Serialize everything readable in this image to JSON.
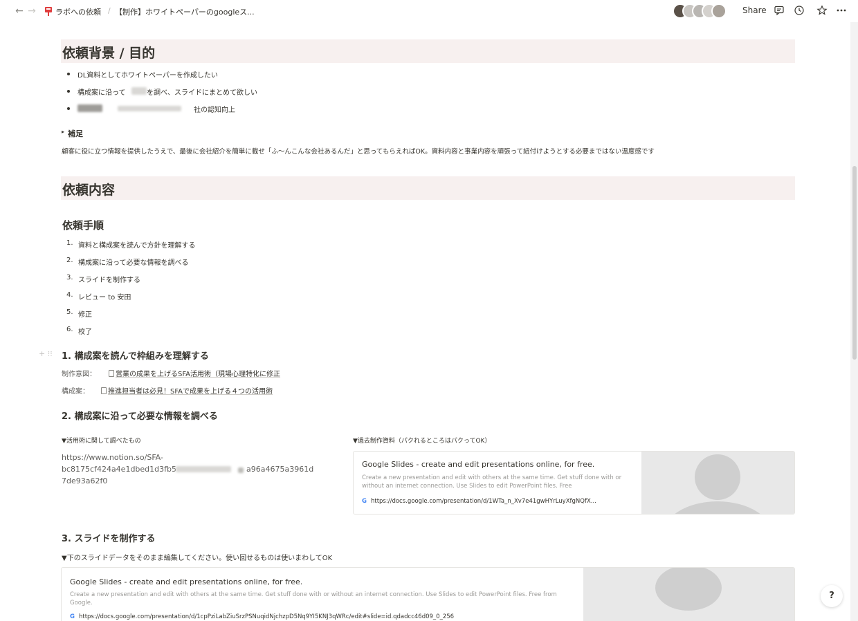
{
  "topbar": {
    "breadcrumb_1": "ラボへの依頼",
    "breadcrumb_sep": "/",
    "breadcrumb_2": "【制作】ホワイトペーパーのgoogleス...",
    "share_label": "Share",
    "back_glyph": "←",
    "forward_glyph": "→",
    "icons": [
      "comment-icon",
      "history-icon",
      "star-icon",
      "more-icon"
    ]
  },
  "section_background": {
    "heading": "依頼背景 / 目的",
    "bullets": [
      "DL資料としてホワイトペーパーを作成したい",
      "構成案に沿って",
      "を調べ、スライドにまとめて欲しい",
      "社の認知向上"
    ],
    "toggle_label": "補足",
    "toggle_glyph": "▸",
    "note": "顧客に役に立つ情報を提供したうえで、最後に会社紹介を簡単に載せ「ふ〜んこんな会社あるんだ」と思ってもらえればOK。資料内容と事業内容を頑張って紐付けようとする必要まではない温度感です"
  },
  "section_request": {
    "heading": "依頼内容",
    "procedure_heading": "依頼手順",
    "steps": [
      {
        "num": "1.",
        "text": "資料と構成案を読んで方針を理解する"
      },
      {
        "num": "2.",
        "text": "構成案に沿って必要な情報を調べる"
      },
      {
        "num": "3.",
        "text": "スライドを制作する"
      },
      {
        "num": "4.",
        "text": "レビュー to 安田"
      },
      {
        "num": "5.",
        "text": "修正"
      },
      {
        "num": "6.",
        "text": "校了"
      }
    ]
  },
  "step1": {
    "heading": "1. 構成案を読んで枠組みを理解する",
    "intent_label": "制作意図：",
    "intent_link": "営業の成果を上げるSFA活用術（現場心理特化に修正",
    "plan_label": "構成案：",
    "plan_link": "推進担当者は必見！SFAで成果を上げる４つの活用術"
  },
  "step2": {
    "heading": "2. 構成案に沿って必要な情報を調べる",
    "left_label": "▼活用術に関して調べたもの",
    "url_line1": "https://www.notion.so/SFA-",
    "url_line2a": "bc8175cf424a4e1dbed1d3fb5",
    "url_line2b": "a96a4675a3961d",
    "url_line3": "7de93a62f0",
    "right_label": "▼過去制作資料（パクれるところはパクってOK）",
    "card": {
      "title": "Google Slides - create and edit presentations online, for free.",
      "desc": "Create a new presentation and edit with others at the same time. Get stuff done with or without an internet connection. Use Slides to edit PowerPoint files. Free",
      "url": "https://docs.google.com/presentation/d/1WTa_n_Xv7e41gwHYrLuyXfgNQfX..."
    }
  },
  "step3": {
    "heading": "3. スライドを制作する",
    "note": "▼下のスライドデータをそのまま編集してください。使い回せるものは使いまわしてOK",
    "card": {
      "title": "Google Slides - create and edit presentations online, for free.",
      "desc": "Create a new presentation and edit with others at the same time. Get stuff done with or without an internet connection. Use Slides to edit PowerPoint files. Free from Google.",
      "url": "https://docs.google.com/presentation/d/1cpPziLabZiuSrzPSNuqidNjchzpD5Nq9YI5KNJ3qWRc/edit#slide=id.qdadcc46d09_0_256"
    }
  },
  "help_label": "?",
  "colors": {
    "heading_band": "#f7f0ef",
    "text": "#37352f",
    "muted": "#9b9a97",
    "accent_red": "#e03e3e"
  }
}
